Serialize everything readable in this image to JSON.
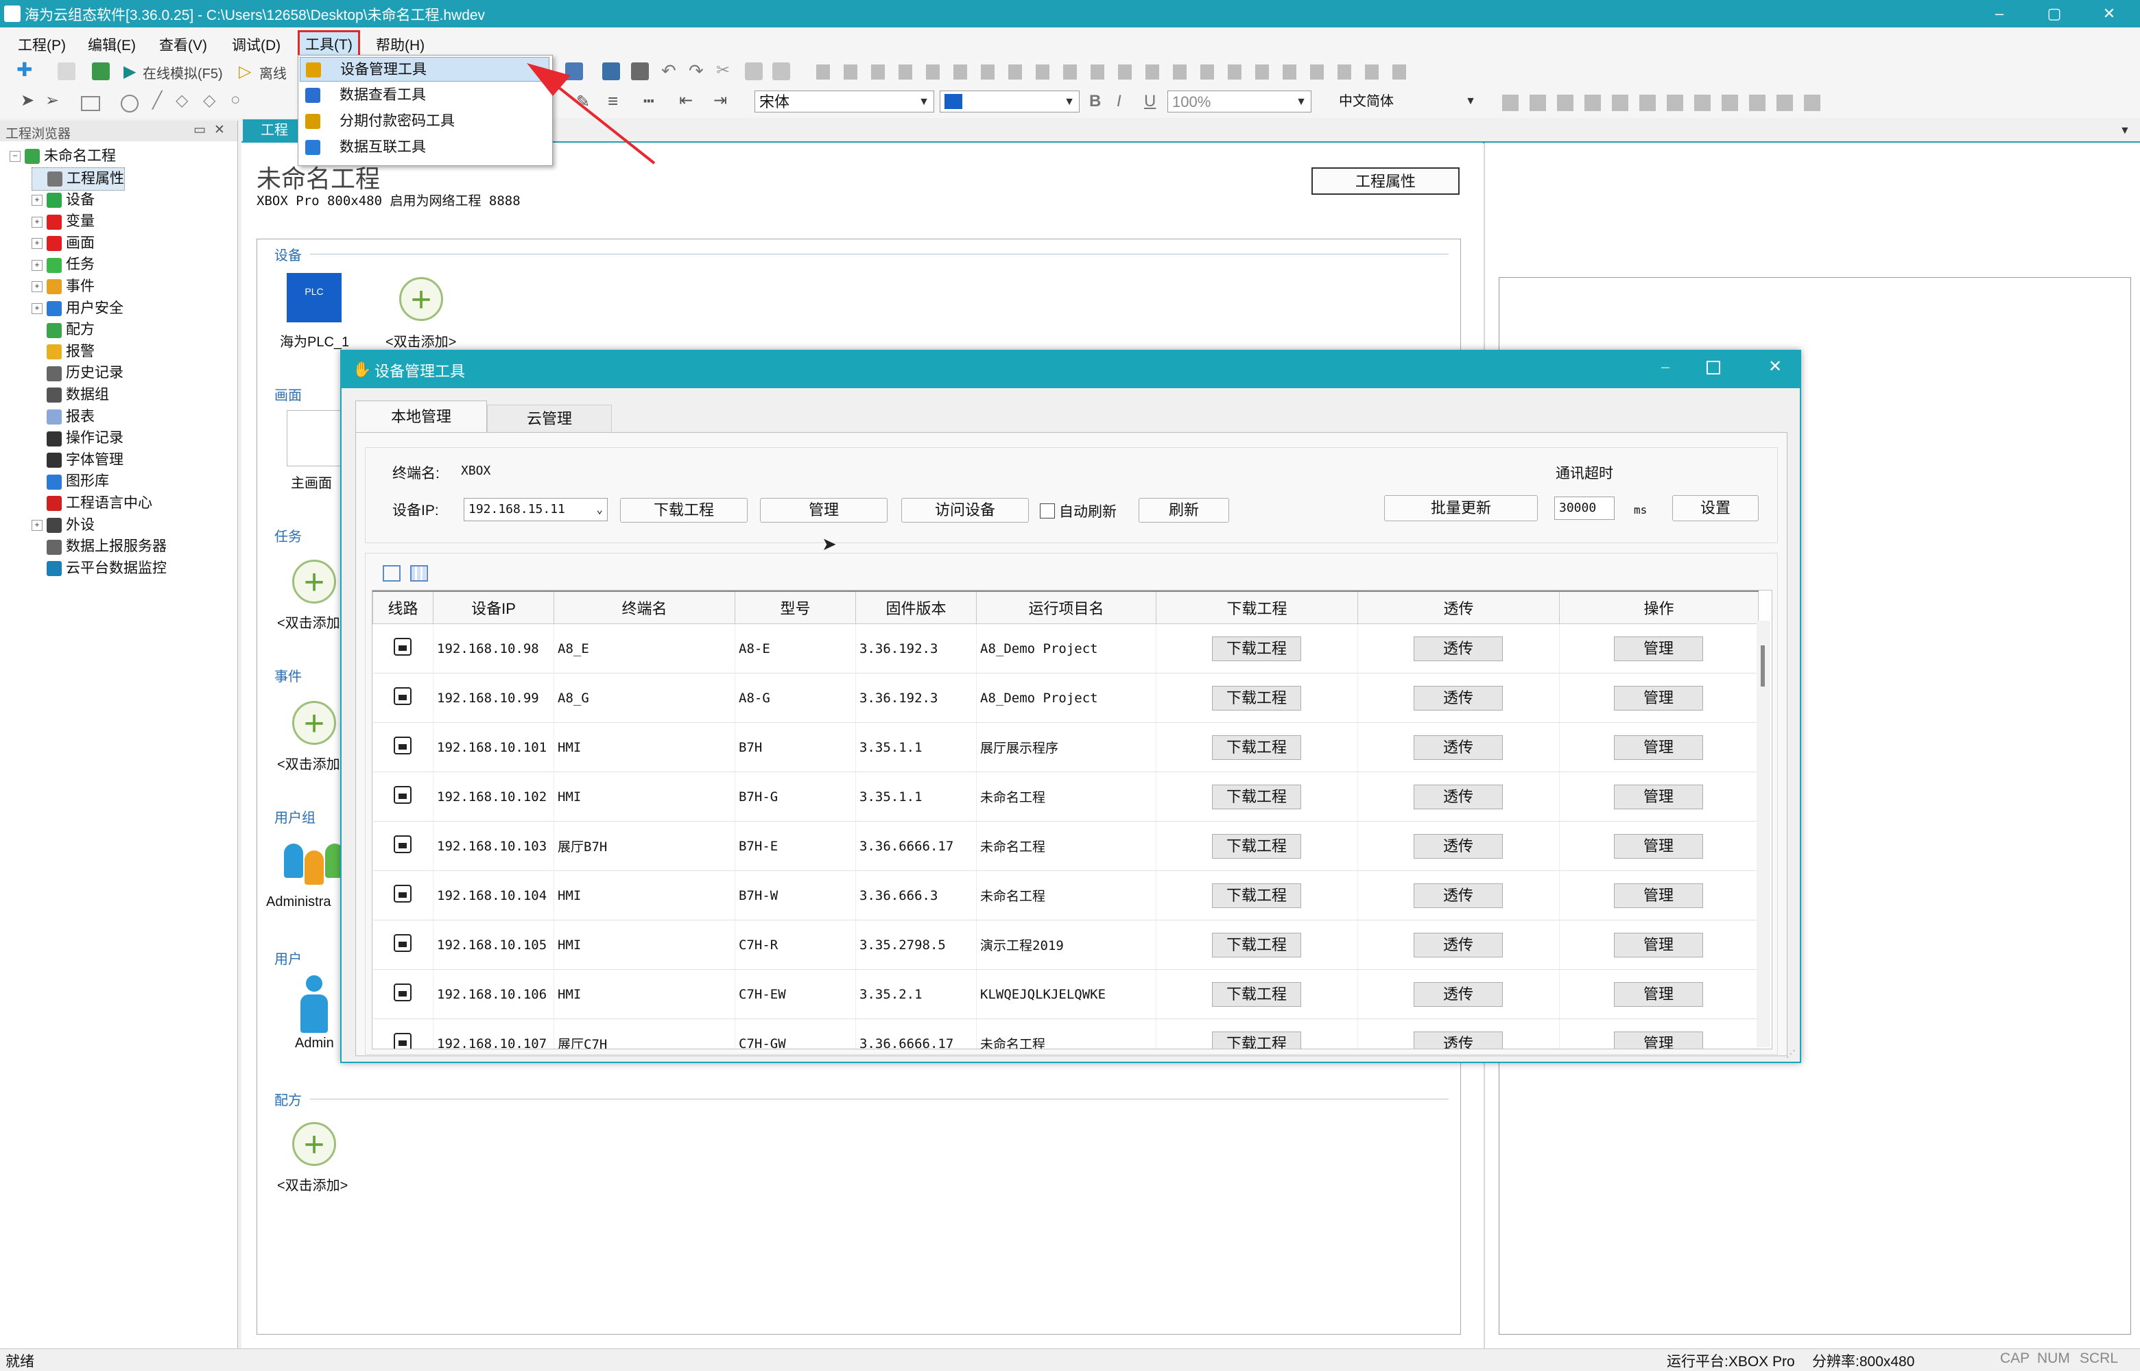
{
  "window": {
    "title": "海为云组态软件[3.36.0.25] - C:\\Users\\12658\\Desktop\\未命名工程.hwdev",
    "min": "–",
    "max": "▢",
    "close": "✕"
  },
  "menubar": {
    "items": [
      "工程(P)",
      "编辑(E)",
      "查看(V)",
      "调试(D)",
      "工具(T)",
      "帮助(H)"
    ]
  },
  "toolbar": {
    "online_sim": "在线模拟(F5)",
    "offline_sim": "离线",
    "font": "宋体",
    "zoom": "100%",
    "language": "中文简体"
  },
  "tools_menu": {
    "items": [
      "设备管理工具",
      "数据查看工具",
      "分期付款密码工具",
      "数据互联工具"
    ],
    "icon_colors": [
      "#e0a000",
      "#2a6fcf",
      "#d89b00",
      "#2a7ad8"
    ]
  },
  "left_panel": {
    "title": "工程浏览器",
    "pin": "▭",
    "close": "✕",
    "root": "未命名工程",
    "items": [
      "工程属性",
      "设备",
      "变量",
      "画面",
      "任务",
      "事件",
      "用户安全",
      "配方",
      "报警",
      "历史记录",
      "数据组",
      "报表",
      "操作记录",
      "字体管理",
      "图形库",
      "工程语言中心",
      "外设",
      "数据上报服务器",
      "云平台数据监控"
    ],
    "icon_colors": [
      "#777",
      "#2aa84a",
      "#e02020",
      "#e02020",
      "#3db74a",
      "#e8a020",
      "#2a7ad8",
      "#3aa54a",
      "#e8b020",
      "#666",
      "#555",
      "#8aa8d8",
      "#333",
      "#333",
      "#2a7ad8",
      "#d02020",
      "#444",
      "#666",
      "#1a80b8"
    ]
  },
  "main": {
    "tab": "工程",
    "project_title": "未命名工程",
    "project_info": "XBOX Pro  800x480  启用为网络工程 8888",
    "props_button": "工程属性",
    "sections": {
      "device": "设备",
      "screen": "画面",
      "task": "任务",
      "event": "事件",
      "user_group": "用户组",
      "user": "用户",
      "recipe": "配方"
    },
    "device_caption": "海为PLC_1",
    "plc_label": "PLC",
    "add_caption": "<双击添加>",
    "screen_caption": "主画面",
    "group_caption": "Administra",
    "user_caption": "Admin"
  },
  "dialog": {
    "title": "设备管理工具",
    "tabs": [
      "本地管理",
      "云管理"
    ],
    "terminal_label": "终端名:",
    "terminal_value": "XBOX",
    "ip_label": "设备IP:",
    "ip_value": "192.168.15.11",
    "buttons": {
      "download": "下载工程",
      "manage": "管理",
      "visit": "访问设备",
      "auto_refresh": "自动刷新",
      "refresh": "刷新",
      "batch": "批量更新",
      "set": "设置"
    },
    "timeout_label": "通讯超时",
    "timeout_value": "30000",
    "timeout_unit": "ms",
    "columns": [
      "线路",
      "设备IP",
      "终端名",
      "型号",
      "固件版本",
      "运行项目名",
      "下载工程",
      "透传",
      "操作"
    ],
    "row_buttons": {
      "download": "下载工程",
      "pass": "透传",
      "manage": "管理"
    },
    "rows": [
      {
        "ip": "192.168.10.98",
        "name": "A8_E",
        "model": "A8-E",
        "fw": "3.36.192.3",
        "project": "A8_Demo Project"
      },
      {
        "ip": "192.168.10.99",
        "name": "A8_G",
        "model": "A8-G",
        "fw": "3.36.192.3",
        "project": "A8_Demo Project"
      },
      {
        "ip": "192.168.10.101",
        "name": "HMI",
        "model": "B7H",
        "fw": "3.35.1.1",
        "project": "展厅展示程序"
      },
      {
        "ip": "192.168.10.102",
        "name": "HMI",
        "model": "B7H-G",
        "fw": "3.35.1.1",
        "project": "未命名工程"
      },
      {
        "ip": "192.168.10.103",
        "name": "展厅B7H",
        "model": "B7H-E",
        "fw": "3.36.6666.17",
        "project": "未命名工程"
      },
      {
        "ip": "192.168.10.104",
        "name": "HMI",
        "model": "B7H-W",
        "fw": "3.36.666.3",
        "project": "未命名工程"
      },
      {
        "ip": "192.168.10.105",
        "name": "HMI",
        "model": "C7H-R",
        "fw": "3.35.2798.5",
        "project": "演示工程2019"
      },
      {
        "ip": "192.168.10.106",
        "name": "HMI",
        "model": "C7H-EW",
        "fw": "3.35.2.1",
        "project": "KLWQEJQLKJELQWKE"
      },
      {
        "ip": "192.168.10.107",
        "name": "展厅C7H",
        "model": "C7H-GW",
        "fw": "3.36.6666.17",
        "project": "未命名工程"
      }
    ]
  },
  "status": {
    "left": "就绪",
    "platform": "运行平台:XBOX Pro",
    "resolution": "分辨率:800x480",
    "cap": "CAP",
    "num": "NUM",
    "scrl": "SCRL"
  },
  "colors": {
    "accent": "#1f9fb5",
    "arrow": "#e8282e"
  }
}
